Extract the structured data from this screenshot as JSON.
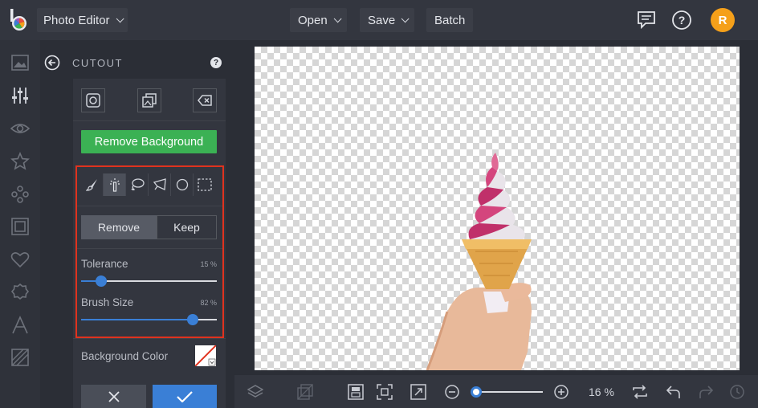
{
  "app": {
    "menu_label": "Photo Editor",
    "avatar_initial": "R"
  },
  "topbar": {
    "open_label": "Open",
    "save_label": "Save",
    "batch_label": "Batch"
  },
  "panel": {
    "title": "CUTOUT",
    "help": "?",
    "remove_bg_label": "Remove Background",
    "toggle": {
      "remove": "Remove",
      "keep": "Keep",
      "selected": "Remove"
    },
    "tolerance": {
      "label": "Tolerance",
      "value_text": "15 %",
      "value": 15
    },
    "brush_size": {
      "label": "Brush Size",
      "value_text": "82 %",
      "value": 82
    },
    "background_color_label": "Background Color"
  },
  "zoom": {
    "label": "16 %",
    "value": 16
  },
  "colors": {
    "accent": "#3a7fd6",
    "remove_bg": "#3bb154",
    "highlight": "#e0321e",
    "avatar": "#f5a01a"
  },
  "icons": {
    "rail": [
      "image-icon",
      "sliders-icon",
      "eye-icon",
      "star-icon",
      "shapes-icon",
      "frame-icon",
      "heart-icon",
      "badge-icon",
      "text-icon",
      "texture-icon"
    ],
    "brush_tools": [
      "brush-icon",
      "magic-wand-icon",
      "lasso-icon",
      "polygon-lasso-icon",
      "ellipse-select-icon",
      "rect-select-icon"
    ]
  }
}
